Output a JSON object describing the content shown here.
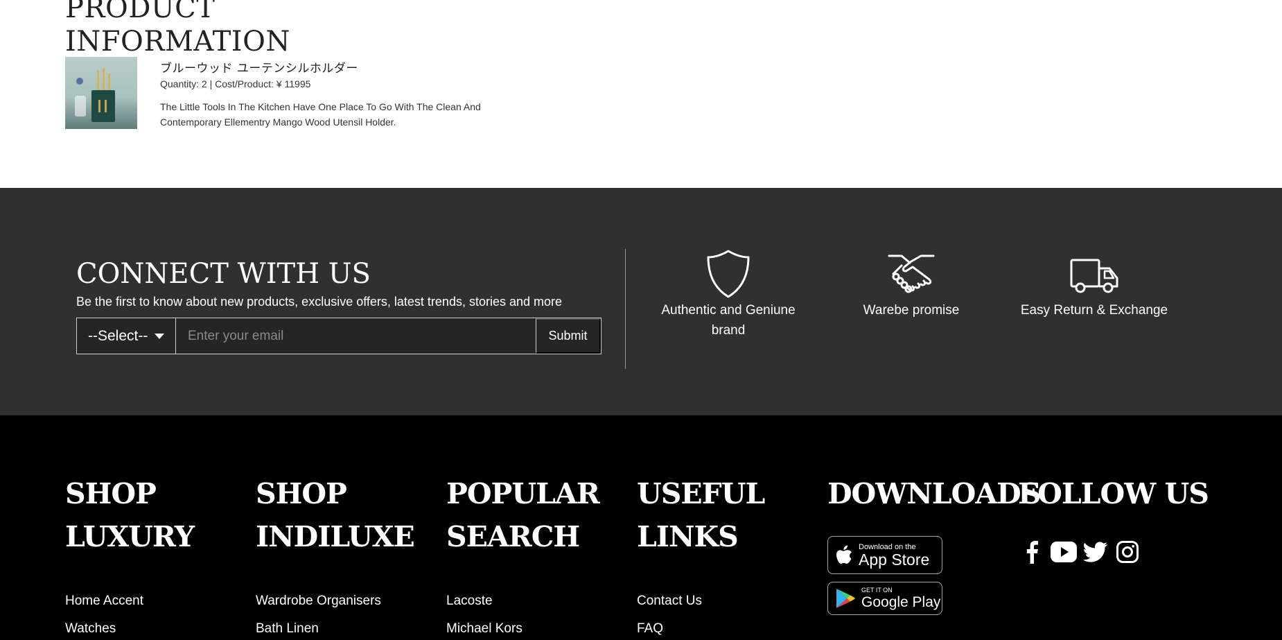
{
  "product_info": {
    "title_line1": "PRODUCT",
    "title_line2": "INFORMATION",
    "name": "ブルーウッド ユーテンシルホルダー",
    "meta": "Quantity: 2 | Cost/Product: ¥ 11995",
    "description": "The Little Tools In The Kitchen Have One Place To Go With The Clean And Contemporary Ellementry Mango Wood Utensil Holder."
  },
  "connect": {
    "title": "CONNECT WITH US",
    "subtitle": "Be the first to know about new products, exclusive offers, latest trends, stories and more",
    "select_label": "--Select--",
    "email_placeholder": "Enter your email",
    "submit_label": "Submit"
  },
  "features": [
    {
      "icon": "shield-icon",
      "label": "Authentic and Geniune brand"
    },
    {
      "icon": "handshake-icon",
      "label": "Warebe promise"
    },
    {
      "icon": "truck-icon",
      "label": "Easy Return & Exchange"
    }
  ],
  "footer": {
    "columns": [
      {
        "title": "SHOP LUXURY",
        "links": [
          "Home Accent",
          "Watches"
        ]
      },
      {
        "title": "SHOP INDILUXE",
        "links": [
          "Wardrobe Organisers",
          "Bath Linen"
        ]
      },
      {
        "title": "POPULAR SEARCH",
        "links": [
          "Lacoste",
          "Michael Kors"
        ]
      },
      {
        "title": "USEFUL LINKS",
        "links": [
          "Contact Us",
          "FAQ"
        ]
      }
    ],
    "downloads": {
      "title": "DOWNLOADS",
      "app_store_small": "Download on the",
      "app_store_big": "App Store",
      "google_small": "GET IT ON",
      "google_big": "Google Play"
    },
    "follow": {
      "title": "FOLLOW US",
      "icons": [
        "facebook-icon",
        "youtube-icon",
        "twitter-icon",
        "instagram-icon"
      ]
    }
  }
}
